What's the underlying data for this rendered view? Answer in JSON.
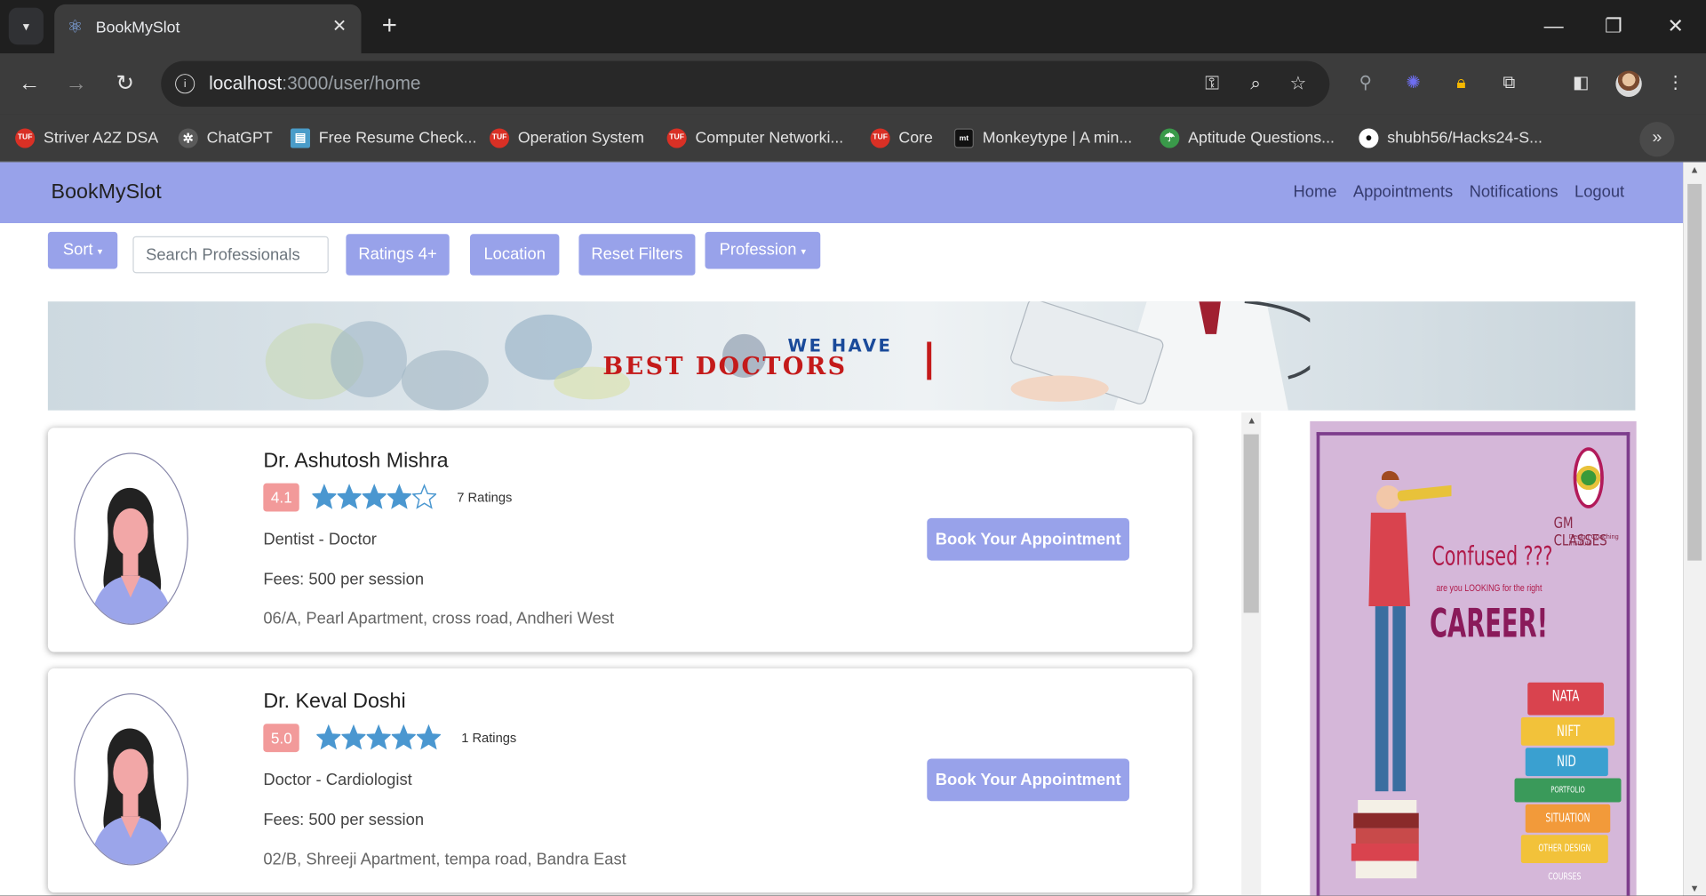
{
  "browser": {
    "tab_title": "BookMySlot",
    "url_host": "localhost",
    "url_rest": ":3000/user/home",
    "bookmarks": [
      {
        "label": "Striver A2Z DSA",
        "icon": "tuf",
        "color": "#d93025"
      },
      {
        "label": "ChatGPT",
        "icon": "chatgpt",
        "color": "#6b6b6b"
      },
      {
        "label": "Free Resume Check...",
        "icon": "resume",
        "color": "#4a9cc9"
      },
      {
        "label": "Operation System",
        "icon": "tuf",
        "color": "#d93025"
      },
      {
        "label": "Computer Networki...",
        "icon": "tuf",
        "color": "#d93025"
      },
      {
        "label": "Core",
        "icon": "tuf",
        "color": "#d93025"
      },
      {
        "label": "Monkeytype | A min...",
        "icon": "mt",
        "color": "#111111"
      },
      {
        "label": "Aptitude Questions...",
        "icon": "indiabix",
        "color": "#3a9a4a"
      },
      {
        "label": "shubh56/Hacks24-S...",
        "icon": "github",
        "color": "#ffffff"
      }
    ]
  },
  "app": {
    "brand": "BookMySlot",
    "nav": [
      "Home",
      "Appointments",
      "Notifications",
      "Logout"
    ],
    "filters": {
      "sort": "Sort",
      "search_placeholder": "Search Professionals",
      "ratings": "Ratings 4+",
      "location": "Location",
      "reset": "Reset Filters",
      "profession": "Profession"
    },
    "banner": {
      "line1": "WE HAVE",
      "line2": "BEST DOCTORS"
    },
    "doctors": [
      {
        "name": "Dr. Ashutosh Mishra",
        "rating": "4.1",
        "rating_value": 4.1,
        "ratings_count": "7 Ratings",
        "profession": "Dentist - Doctor",
        "fees": "Fees: 500 per session",
        "address": "06/A, Pearl Apartment, cross road, Andheri West",
        "book_label": "Book Your Appointment"
      },
      {
        "name": "Dr. Keval Doshi",
        "rating": "5.0",
        "rating_value": 5.0,
        "ratings_count": "1 Ratings",
        "profession": "Doctor - Cardiologist",
        "fees": "Fees: 500 per session",
        "address": "02/B, Shreeji Apartment, tempa road, Bandra East",
        "book_label": "Book Your Appointment"
      }
    ],
    "ad": {
      "brand": "GM CLASSES",
      "tagline": "Design Coaching Institute",
      "headline1": "Confused ???",
      "headline2": "are you LOOKING for the right",
      "headline3": "CAREER!",
      "courses": [
        "NATA",
        "NIFT",
        "NID",
        "PORTFOLIO DEVELOPMENT",
        "SITUATION TEST",
        "OTHER DESIGN COURSES"
      ]
    },
    "colors": {
      "accent": "#98a2ea",
      "star": "#4a97d0",
      "badge": "#f29a9a"
    }
  }
}
